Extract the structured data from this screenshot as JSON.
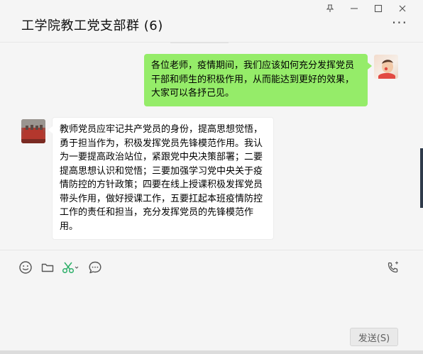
{
  "window": {
    "title": "工学院教工党支部群 (6)",
    "controls": {
      "pin": "⍊",
      "minimize": "—",
      "maximize": "☐",
      "close": "✕"
    },
    "more": "···"
  },
  "messages": [
    {
      "sender": "me",
      "text": "各位老师，疫情期间，我们应该如何充分发挥党员干部和师生的积极作用，从而能达到更好的效果，大家可以各抒己见。",
      "bubble_color": "#95ec69"
    },
    {
      "sender": "other",
      "text": "教师党员应牢记共产党员的身份，提高思想觉悟，勇于担当作为，积极发挥党员先锋模范作用。我认为一要提高政治站位，紧跟党中央决策部署；二要提高思想认识和觉悟；三要加强学习党中央关于疫情防控的方针政策；四要在线上授课积极发挥党员带头作用，做好授课工作，五要扛起本班疫情防控工作的责任和担当，充分发挥党员的先锋模范作用。",
      "bubble_color": "#ffffff"
    }
  ],
  "toolbar": {
    "icons": [
      "emoji-icon",
      "folder-icon",
      "scissors-icon",
      "chat-history-icon",
      "voice-call-icon"
    ],
    "accent": "#2aae67"
  },
  "composer": {
    "send_label": "发送(S)"
  }
}
